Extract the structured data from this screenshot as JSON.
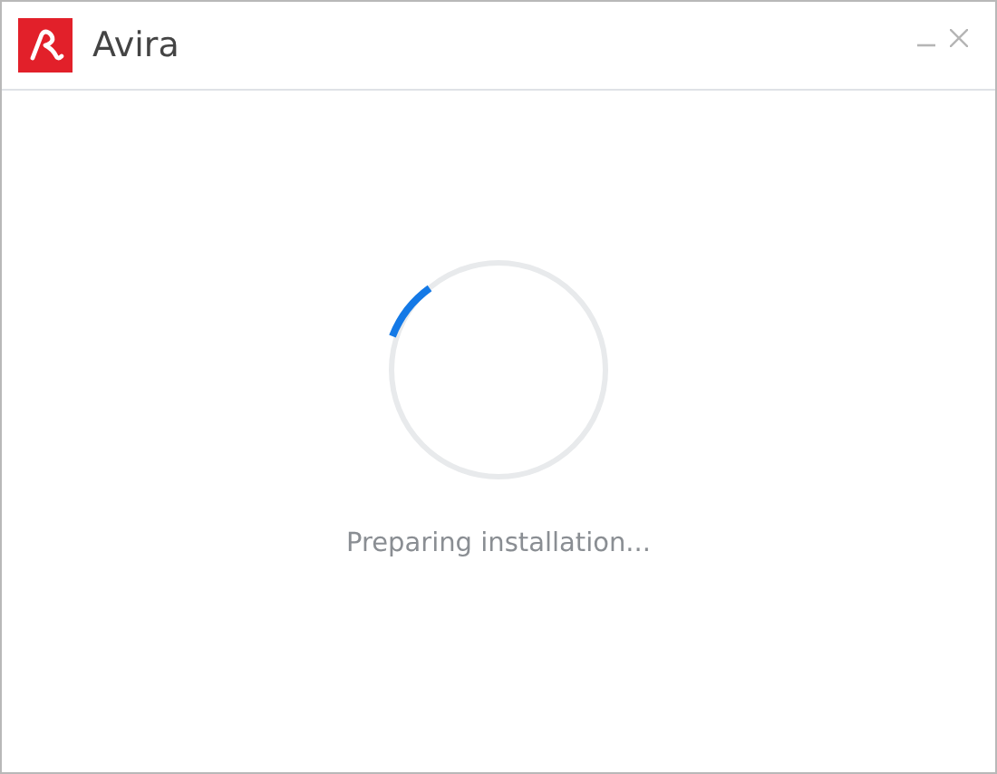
{
  "window": {
    "title": "Avira",
    "controls": [
      {
        "kind": "minimize"
      },
      {
        "kind": "close"
      }
    ]
  },
  "status": {
    "message": "Preparing installation..."
  }
}
